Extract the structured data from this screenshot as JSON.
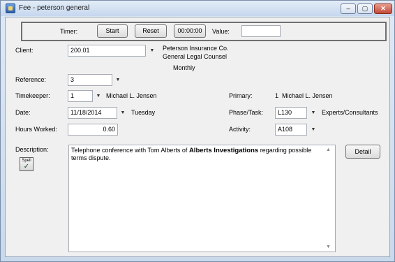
{
  "window": {
    "title": "Fee - peterson general",
    "min_glyph": "–",
    "max_glyph": "▢",
    "close_glyph": "✕"
  },
  "timer": {
    "label": "Timer:",
    "start_label": "Start",
    "reset_label": "Reset",
    "elapsed": "00:00:00",
    "value_label": "Value:",
    "value": ""
  },
  "client": {
    "label": "Client:",
    "value": "200.01",
    "name_line1": "Peterson Insurance Co.",
    "name_line2": "General Legal Counsel",
    "billing": "Monthly"
  },
  "reference": {
    "label": "Reference:",
    "value": "3"
  },
  "timekeeper": {
    "label": "Timekeeper:",
    "value": "1",
    "name": "Michael L. Jensen"
  },
  "primary": {
    "label": "Primary:",
    "value": "1  Michael L. Jensen"
  },
  "date": {
    "label": "Date:",
    "value": "11/18/2014",
    "weekday": "Tuesday"
  },
  "phase_task": {
    "label": "Phase/Task:",
    "value": "L130",
    "description": "Experts/Consultants"
  },
  "hours": {
    "label": "Hours Worked:",
    "value": "0.60"
  },
  "activity": {
    "label": "Activity:",
    "value": "A108"
  },
  "description": {
    "label": "Description:",
    "text_before": "Telephone conference with Tom Alberts of ",
    "text_bold": "Alberts Investigations",
    "text_after": " regarding possible terms dispute."
  },
  "detail_button": {
    "label": "Detail"
  },
  "spell_icon": {
    "label": "Spell",
    "glyph": "✓"
  },
  "dropdown_glyph": "▼"
}
